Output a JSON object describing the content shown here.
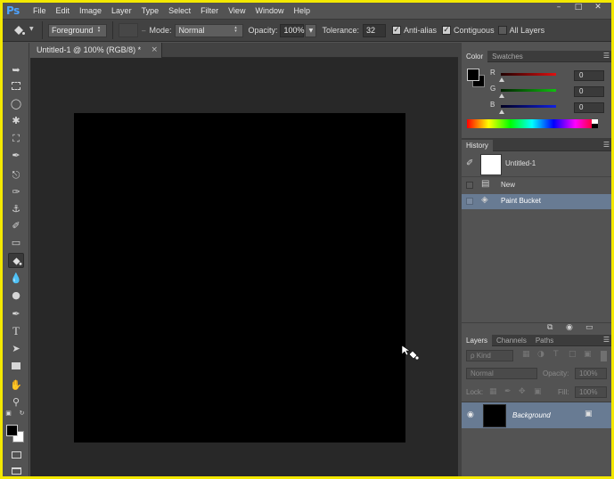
{
  "app": {
    "logo": "Ps"
  },
  "menu": [
    "File",
    "Edit",
    "Image",
    "Layer",
    "Type",
    "Select",
    "Filter",
    "View",
    "Window",
    "Help"
  ],
  "window_controls": {
    "minimize": "–",
    "maximize": "□",
    "close": "✕"
  },
  "options": {
    "fill_source": "Foreground",
    "mode_label": "Mode:",
    "mode_value": "Normal",
    "opacity_label": "Opacity:",
    "opacity_value": "100%",
    "tolerance_label": "Tolerance:",
    "tolerance_value": "32",
    "antialias_label": "Anti-alias",
    "antialias_checked": true,
    "contiguous_label": "Contiguous",
    "contiguous_checked": true,
    "all_layers_label": "All Layers",
    "all_layers_checked": false
  },
  "document": {
    "tab_title": "Untitled-1 @ 100% (RGB/8) *",
    "tab_close": "×",
    "canvas_color": "#000000"
  },
  "tools": [
    "move-tool",
    "marquee-tool",
    "lasso-tool",
    "magic-wand-tool",
    "crop-tool",
    "eyedropper-tool",
    "spot-healing-tool",
    "brush-tool",
    "clone-stamp-tool",
    "history-brush-tool",
    "eraser-tool",
    "paint-bucket-tool",
    "blur-tool",
    "dodge-tool",
    "pen-tool",
    "type-tool",
    "path-selection-tool",
    "rectangle-tool",
    "hand-tool",
    "zoom-tool"
  ],
  "color_panel": {
    "tabs": [
      "Color",
      "Swatches"
    ],
    "channels": [
      {
        "label": "R",
        "value": "0",
        "color": "#d01010"
      },
      {
        "label": "G",
        "value": "0",
        "color": "#10b010"
      },
      {
        "label": "B",
        "value": "0",
        "color": "#1020d0"
      }
    ]
  },
  "history_panel": {
    "tab": "History",
    "snapshot": "Untitled-1",
    "items": [
      {
        "label": "New",
        "icon": "document-icon"
      },
      {
        "label": "Paint Bucket",
        "icon": "paint-bucket-icon",
        "selected": true
      }
    ]
  },
  "layers_panel": {
    "tabs": [
      "Layers",
      "Channels",
      "Paths"
    ],
    "kind_label": "ρ Kind",
    "blend_mode": "Normal",
    "opacity_label": "Opacity:",
    "opacity_value": "100%",
    "lock_label": "Lock:",
    "fill_label": "Fill:",
    "fill_value": "100%",
    "layers": [
      {
        "name": "Background",
        "thumb_color": "#000000",
        "locked": true,
        "visible": true
      }
    ]
  },
  "colors": {
    "accent_selected": "#687b93",
    "frame": "#f3e800"
  }
}
